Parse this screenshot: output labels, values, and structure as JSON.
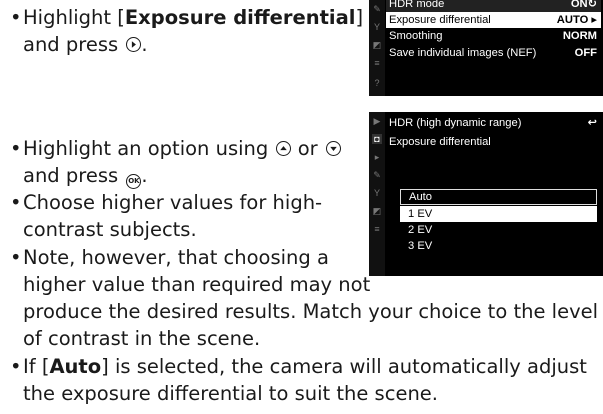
{
  "text": {
    "p1_a": "Highlight [",
    "p1_b": "Exposure differential",
    "p1_c": "]",
    "p1_d": "and press",
    "p2_a": "Highlight an option using",
    "p2_b": "or",
    "p2_c": "and press",
    "p3_a": "Choose higher values for high-",
    "p3_b": "contrast subjects.",
    "p4_a": "Note, however, that choosing a",
    "p4_b": "higher value than required may not",
    "p4_c": "produce the desired results. Match your choice to the level",
    "p4_d": "of contrast in the scene.",
    "p5_a": "If [",
    "p5_b": "Auto",
    "p5_c": "] is selected, the camera will automatically adjust",
    "p5_d": "the exposure differential to suit the scene.",
    "bullet": "•",
    "ok_label": "OK"
  },
  "screen1": {
    "rows": [
      {
        "label": "HDR mode",
        "value": "ON↻"
      },
      {
        "label": "Exposure differential",
        "value": "AUTO ▸"
      },
      {
        "label": "Smoothing",
        "value": "NORM"
      },
      {
        "label": "Save individual images (NEF)",
        "value": "OFF"
      }
    ]
  },
  "screen2": {
    "title": "HDR (high dynamic range)",
    "back": "↩",
    "subtitle": "Exposure differential",
    "options": [
      "Auto",
      "1 EV",
      "2 EV",
      "3 EV"
    ]
  }
}
